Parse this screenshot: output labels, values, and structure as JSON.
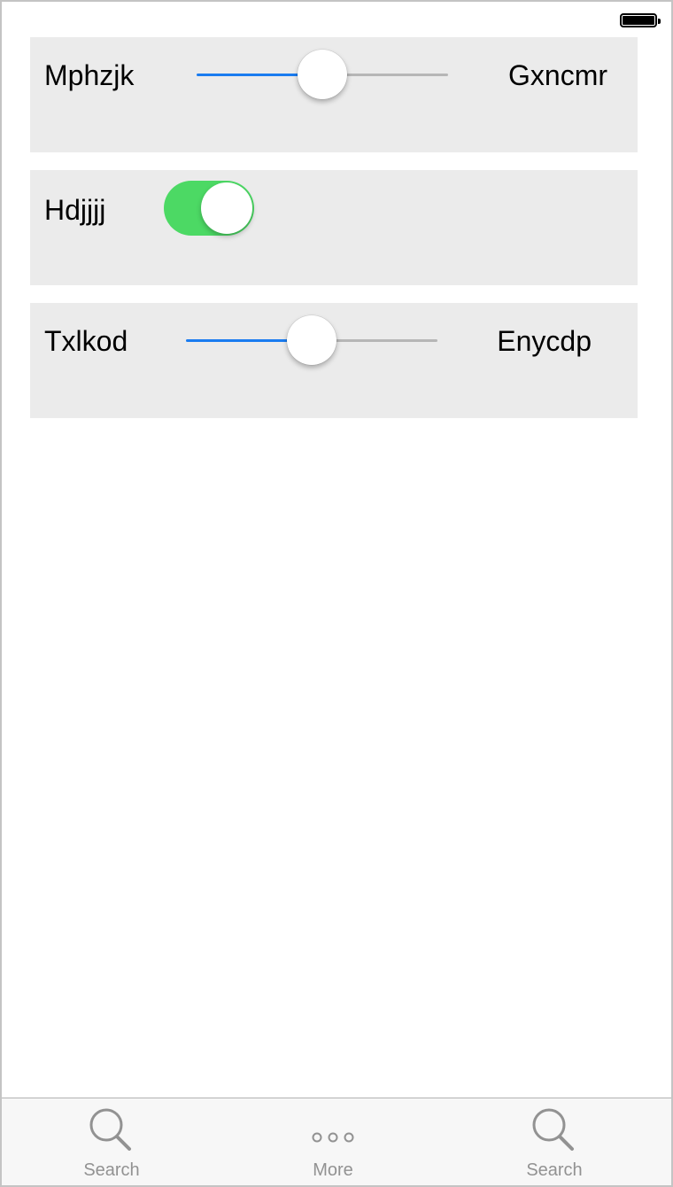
{
  "status_bar": {
    "battery_icon": "battery-icon"
  },
  "rows": [
    {
      "type": "slider",
      "label_left": "Mphzjk",
      "label_right": "Gxncmr",
      "value": 0.5
    },
    {
      "type": "toggle",
      "label": "Hdjjjj",
      "on": true
    },
    {
      "type": "slider",
      "label_left": "Txlkod",
      "label_right": "Enycdp",
      "value": 0.5
    }
  ],
  "tab_bar": {
    "tabs": [
      {
        "label": "Search",
        "icon": "search-icon"
      },
      {
        "label": "More",
        "icon": "more-icon"
      },
      {
        "label": "Search",
        "icon": "search-icon"
      }
    ]
  },
  "colors": {
    "slider_min_track": "#1a7cf0",
    "slider_max_track": "#b6b6b6",
    "toggle_on": "#4cd964",
    "card_background": "#ebebeb",
    "tab_label": "#929292"
  }
}
